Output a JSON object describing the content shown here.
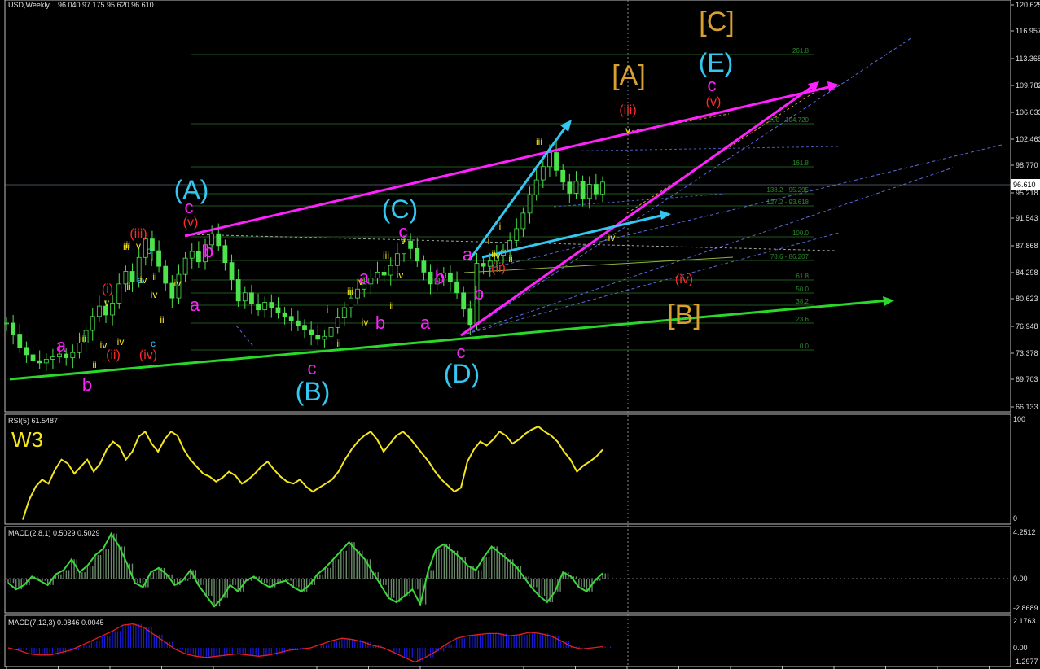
{
  "colors": {
    "bg": "#000000",
    "panel_border": "#c0c0c0",
    "candle": "#4ce34c",
    "magenta": "#ff22ff",
    "cyan": "#33c7f2",
    "yellow": "#f5e71c",
    "red": "#ff2a2a",
    "orange": "#d8a030",
    "green_line": "#2ad82a",
    "fib": "#1f5a1f",
    "fib_text": "#2a8a2a",
    "blue_dash": "#5b6bd8",
    "rsi": "#f5e71c",
    "macd_fill": "#6a8a6a",
    "macd_line": "#3ad83a",
    "macd2_fill": "#1a1ae0",
    "macd2_line": "#e02020",
    "axis_text": "#e0e0e0"
  },
  "chart_data": [
    {
      "type": "candlestick",
      "title": "USD,Weekly",
      "ohlc_header": "96.040 97.175 95.620 96.610",
      "y_ticks": [
        "120.625",
        "116.957",
        "113.368",
        "109.782",
        "106.033",
        "102.463",
        "98.770",
        "96.610",
        "95.218",
        "91.543",
        "87.868",
        "84.298",
        "80.623",
        "76.948",
        "73.378",
        "69.703",
        "66.133"
      ],
      "current_price": "96.610",
      "close_series": [
        77.5,
        76.0,
        74.2,
        73.2,
        72.4,
        72.1,
        72.6,
        72.9,
        73.3,
        72.8,
        73.5,
        74.8,
        76.5,
        78.4,
        79.8,
        78.6,
        80.2,
        82.8,
        84.5,
        83.1,
        86.4,
        88.9,
        87.3,
        85.2,
        82.9,
        80.9,
        84.1,
        86.3,
        87.2,
        85.8,
        88.1,
        89.6,
        88.0,
        85.7,
        83.4,
        80.5,
        81.6,
        80.1,
        79.3,
        80.3,
        79.6,
        78.9,
        78.4,
        77.8,
        77.2,
        76.6,
        75.9,
        75.3,
        75.7,
        76.9,
        78.2,
        79.6,
        80.9,
        82.1,
        82.8,
        83.6,
        84.4,
        84.0,
        85.3,
        86.9,
        88.6,
        87.6,
        85.9,
        84.4,
        82.8,
        83.6,
        84.3,
        83.1,
        81.6,
        79.4,
        77.3,
        85.6,
        85.2,
        85.9,
        86.7,
        87.4,
        88.7,
        90.3,
        92.4,
        94.9,
        96.9,
        98.7,
        100.6,
        98.2,
        96.6,
        95.1,
        96.7,
        94.4,
        96.3,
        95.0,
        96.6
      ],
      "fib_levels": [
        "261.8",
        "200 - 104.720",
        "161.8",
        "138.2 - 95.295",
        "127.2 - 93.618",
        "100.0",
        "78.6 - 86.207",
        "61.8",
        "50.0",
        "38.2",
        "23.6",
        "0.0"
      ],
      "wave_labels": {
        "magenta": [
          "a",
          "b",
          "c",
          "a",
          "b",
          "c",
          "a",
          "b",
          "a",
          "b",
          "c",
          "a",
          "b",
          "c",
          "c"
        ],
        "cyan": [
          "(A)",
          "(B)",
          "(C)",
          "(D)",
          "(E)",
          "a",
          "b",
          "c"
        ],
        "yellow": [
          "iii",
          "v",
          "ii",
          "iv",
          "iv",
          "iii",
          "v",
          "ii",
          "iv",
          "iii",
          "iv",
          "ii",
          "i",
          "ii",
          "iv",
          "i",
          "ii",
          "iii",
          "v",
          "iv",
          "iii",
          "i",
          "iv",
          "ii",
          "v",
          "iii",
          "iv",
          "ii",
          "i",
          "ii",
          "iv",
          "v"
        ],
        "red": [
          "(i)",
          "(ii)",
          "(iii)",
          "(iv)",
          "(v)",
          "(ii)",
          "(iii)",
          "(iv)",
          "(v)"
        ],
        "orange": [
          "[A]",
          "[B]",
          "[C]"
        ]
      }
    },
    {
      "type": "line",
      "title": "RSI(5) 61.5487",
      "overlay_text": "W3",
      "y_ticks": [
        "100",
        "0"
      ],
      "values": [
        2,
        22,
        35,
        42,
        38,
        52,
        62,
        58,
        48,
        55,
        62,
        50,
        58,
        72,
        80,
        75,
        62,
        70,
        85,
        90,
        78,
        70,
        82,
        90,
        86,
        72,
        62,
        55,
        48,
        45,
        40,
        44,
        50,
        46,
        38,
        42,
        48,
        55,
        60,
        52,
        45,
        40,
        38,
        42,
        35,
        30,
        34,
        38,
        42,
        50,
        62,
        72,
        80,
        86,
        90,
        82,
        70,
        78,
        86,
        90,
        84,
        76,
        68,
        60,
        50,
        42,
        36,
        30,
        34,
        60,
        72,
        80,
        76,
        82,
        90,
        86,
        78,
        82,
        88,
        92,
        95,
        90,
        86,
        80,
        70,
        62,
        50,
        56,
        60,
        65,
        72
      ]
    },
    {
      "type": "bar",
      "title": "MACD(2,8,1) 0.5029 0.5029",
      "y_ticks": [
        "4.2512",
        "0.00",
        "-2.8689"
      ],
      "values": [
        -0.4,
        -1.0,
        -0.6,
        0.2,
        -0.2,
        -0.6,
        0.4,
        0.8,
        1.8,
        0.6,
        1.2,
        2.2,
        2.8,
        4.2,
        3.0,
        1.4,
        -0.4,
        -0.8,
        0.6,
        1.0,
        0.4,
        -0.6,
        -0.2,
        0.8,
        -0.6,
        -1.6,
        -2.6,
        -1.8,
        -0.6,
        -1.2,
        -0.2,
        0.2,
        -0.4,
        -0.8,
        -0.4,
        -0.2,
        -0.8,
        -1.2,
        -0.6,
        0.4,
        1.0,
        1.8,
        2.6,
        3.4,
        2.6,
        1.8,
        0.6,
        -0.6,
        -1.8,
        -2.2,
        -1.6,
        -1.0,
        -2.4,
        0.8,
        2.8,
        3.2,
        2.6,
        2.0,
        1.2,
        0.8,
        2.0,
        3.0,
        2.4,
        1.8,
        1.2,
        0.2,
        -0.8,
        -1.6,
        -2.2,
        -1.2,
        0.6,
        0.2,
        -0.8,
        -1.2,
        -0.2,
        0.5
      ]
    },
    {
      "type": "area",
      "title": "MACD(7,12,3) 0.0846 0.0045",
      "y_ticks": [
        "2.1763",
        "0.00",
        "-1.2977"
      ],
      "values": [
        0,
        -0.2,
        -0.5,
        -0.6,
        -0.6,
        -0.4,
        -0.2,
        0.2,
        0.6,
        1.0,
        1.4,
        1.9,
        2.0,
        1.7,
        1.1,
        0.5,
        -0.1,
        -0.5,
        -0.7,
        -0.8,
        -0.7,
        -0.6,
        -0.5,
        -0.6,
        -0.7,
        -0.6,
        -0.4,
        -0.2,
        -0.1,
        0,
        0.3,
        0.6,
        0.8,
        0.7,
        0.5,
        0.2,
        0,
        -0.4,
        -0.8,
        -1.2,
        -0.8,
        -0.3,
        0.3,
        0.8,
        1.0,
        1.1,
        1.2,
        1.2,
        1.0,
        1.1,
        1.3,
        1.2,
        1.0,
        0.6,
        0.1,
        -0.1,
        0,
        0.1
      ]
    }
  ]
}
